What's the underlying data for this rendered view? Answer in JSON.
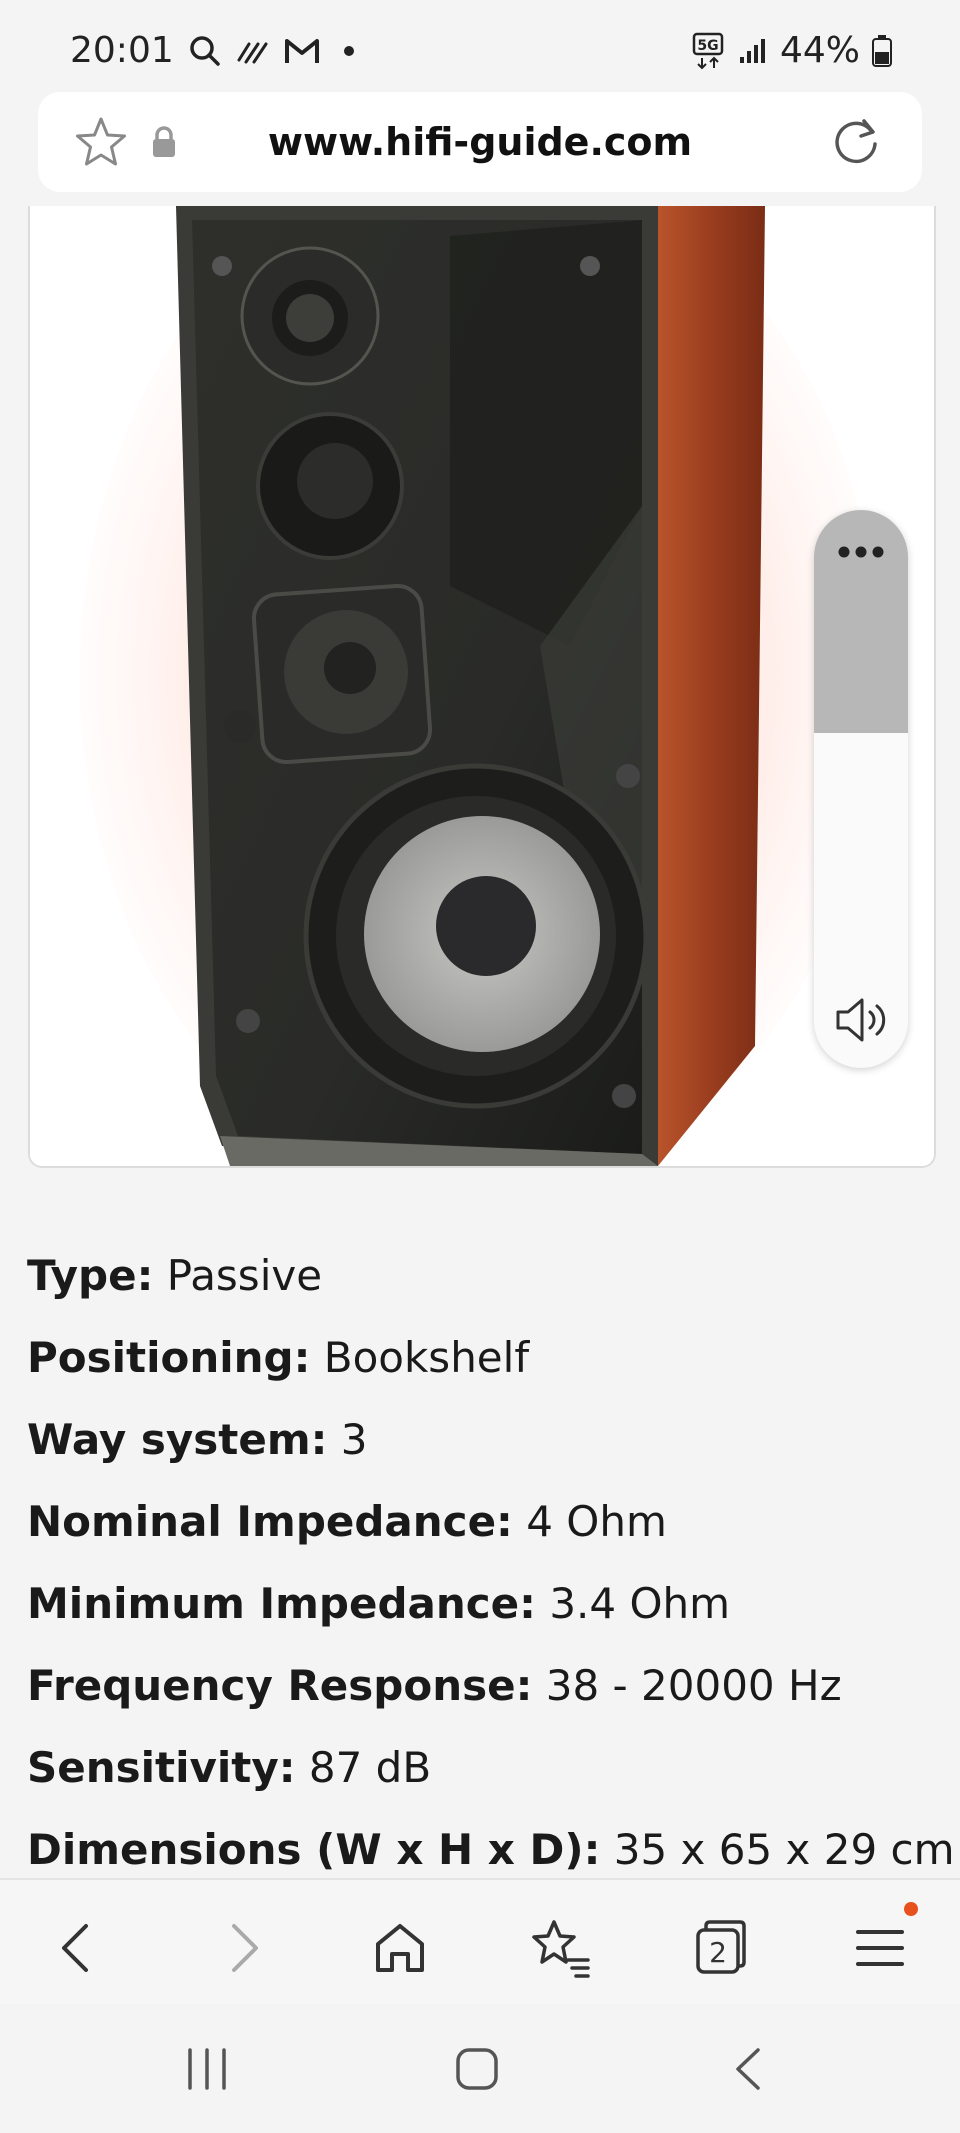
{
  "status_bar": {
    "time": "20:01",
    "network": "5G",
    "battery": "44%"
  },
  "url_bar": {
    "url": "www.hifi-guide.com"
  },
  "image": {
    "subject": "three-way bookshelf loudspeaker with wooden side panel"
  },
  "volume_overlay": {
    "level": 0.6
  },
  "specs": [
    {
      "label": "Type:",
      "value": "Passive"
    },
    {
      "label": "Positioning:",
      "value": "Bookshelf"
    },
    {
      "label": "Way system:",
      "value": "3"
    },
    {
      "label": "Nominal Impedance:",
      "value": "4 Ohm"
    },
    {
      "label": "Minimum Impedance:",
      "value": "3.4 Ohm"
    },
    {
      "label": "Frequency Response:",
      "value": "38 - 20000 Hz"
    },
    {
      "label": "Sensitivity:",
      "value": "87 dB"
    },
    {
      "label": "Dimensions (W x H x D):",
      "value": "35 x 65 x 29 cm"
    }
  ],
  "browser_bar": {
    "tab_count": "2",
    "icons": [
      "back-icon",
      "forward-icon",
      "home-icon",
      "bookmarks-icon",
      "tabs-icon",
      "menu-icon"
    ],
    "notification_color": "#e8501d"
  },
  "system_nav": {
    "icons": [
      "recent-apps-icon",
      "home-icon",
      "back-icon"
    ]
  }
}
